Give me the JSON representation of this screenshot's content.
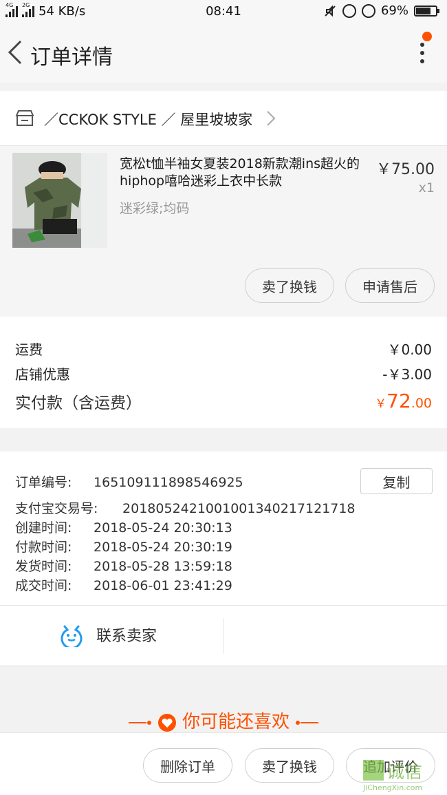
{
  "status_bar": {
    "network_type": "4G",
    "network_type_2": "2G",
    "speed": "54 KB/s",
    "time": "08:41",
    "battery": "69%",
    "battery_level": 0.69
  },
  "nav": {
    "title": "订单详情"
  },
  "shop": {
    "name": "／CCKOK STYLE ／ 屋里坡坡家"
  },
  "goods": {
    "title": "宽松t恤半袖女夏装2018新款潮ins超火的hiphop嘻哈迷彩上衣中长款",
    "sku": "迷彩绿;均码",
    "price": "￥75.00",
    "quantity": "x1",
    "actions": [
      "卖了换钱",
      "申请售后"
    ]
  },
  "fees": {
    "shipping_label": "运费",
    "shipping_value": "￥0.00",
    "discount_label": "店铺优惠",
    "discount_value": "-￥3.00",
    "paid_label": "实付款（含运费）",
    "paid_currency": "￥",
    "paid_int": "72",
    "paid_dec": ".00"
  },
  "order_info": {
    "order_no_label": "订单编号:",
    "order_no": "165109111898546925",
    "copy_label": "复制",
    "alipay_label": "支付宝交易号:",
    "alipay_no": "2018052421001001340217121718",
    "created_label": "创建时间:",
    "created": "2018-05-24 20:30:13",
    "paid_label": "付款时间:",
    "paid": "2018-05-24 20:30:19",
    "shipped_label": "发货时间:",
    "shipped": "2018-05-28 13:59:18",
    "completed_label": "成交时间:",
    "completed": "2018-06-01 23:41:29"
  },
  "contact": {
    "label": "联系卖家",
    "icon": "chat-face-icon"
  },
  "recommend": {
    "title": "你可能还喜欢"
  },
  "bottom_bar": {
    "delete_label": "删除订单",
    "resell_label": "卖了换钱",
    "review_label": "追加评价"
  },
  "watermark": {
    "text": "诚信",
    "url_text": "JiChengXin.com"
  },
  "colors": {
    "accent": "#ff5000",
    "chat_blue": "#1e9bf0"
  }
}
